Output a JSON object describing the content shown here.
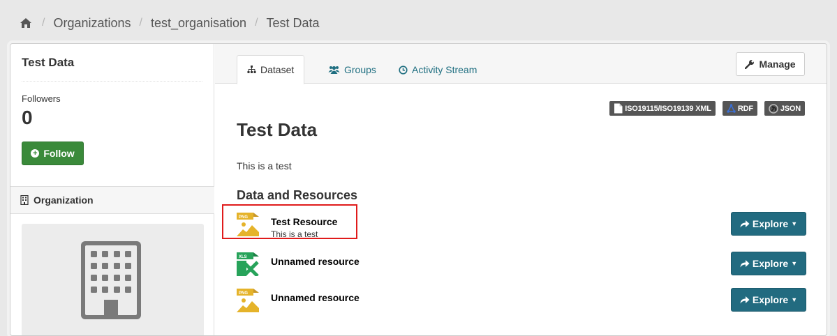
{
  "breadcrumb": {
    "home_icon": "home-icon",
    "items": [
      "Organizations",
      "test_organisation",
      "Test Data"
    ],
    "separator": "/"
  },
  "sidebar": {
    "title": "Test Data",
    "followers_label": "Followers",
    "followers_count": "0",
    "follow_label": "Follow",
    "organization_label": "Organization"
  },
  "tabs": [
    {
      "label": "Dataset",
      "icon": "sitemap-icon",
      "active": true
    },
    {
      "label": "Groups",
      "icon": "users-icon",
      "active": false
    },
    {
      "label": "Activity Stream",
      "icon": "clock-icon",
      "active": false
    }
  ],
  "manage_label": "Manage",
  "formats": [
    {
      "label": "ISO19115/ISO19139 XML",
      "icon": "file-icon"
    },
    {
      "label": "RDF",
      "icon": "rdf-icon"
    },
    {
      "label": "JSON",
      "icon": "json-icon"
    }
  ],
  "dataset": {
    "title": "Test Data",
    "description": "This is a test",
    "resources_heading": "Data and Resources"
  },
  "resources": [
    {
      "name": "Test Resource",
      "description": "This is a test",
      "format": "PNG",
      "explore_label": "Explore"
    },
    {
      "name": "Unnamed resource",
      "description": "",
      "format": "XLS",
      "explore_label": "Explore"
    },
    {
      "name": "Unnamed resource",
      "description": "",
      "format": "PNG",
      "explore_label": "Explore"
    }
  ],
  "colors": {
    "accent": "#226b80",
    "follow_green": "#3a8a3a",
    "badge_gray": "#555555",
    "highlight_red": "#e01b1b",
    "png_yellow": "#e5b32a",
    "xls_green": "#27a35a"
  }
}
